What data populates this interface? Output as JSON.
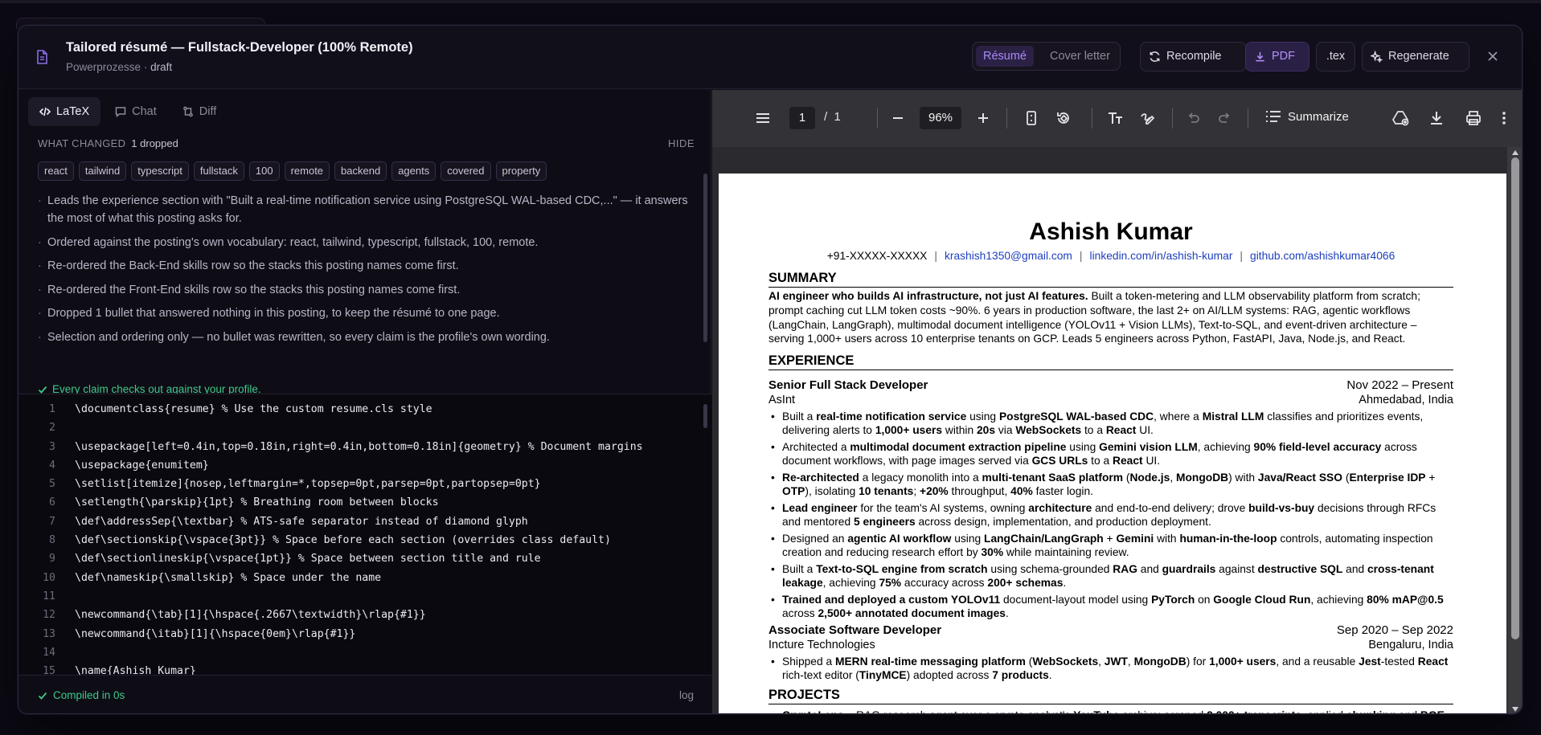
{
  "header": {
    "title": "Tailored résumé — Fullstack-Developer (100% Remote)",
    "company": "Powerprozesse",
    "separator": "·",
    "status": "draft",
    "seg_resume": "Résumé",
    "seg_cover": "Cover letter",
    "recompile": "Recompile",
    "pdf": "PDF",
    "tex": ".tex",
    "regenerate": "Regenerate"
  },
  "left": {
    "tabs": [
      "LaTeX",
      "Chat",
      "Diff"
    ],
    "what_changed": "WHAT CHANGED",
    "dropped": "1 dropped",
    "hide": "HIDE",
    "chips": [
      "react",
      "tailwind",
      "typescript",
      "fullstack",
      "100",
      "remote",
      "backend",
      "agents",
      "covered",
      "property"
    ],
    "notes": [
      "Leads the experience section with \"Built a real-time notification service using PostgreSQL WAL-based CDC,...\" — it answers the most of what this posting asks for.",
      "Ordered against the posting's own vocabulary: react, tailwind, typescript, fullstack, 100, remote.",
      "Re-ordered the Back-End skills row so the stacks this posting names come first.",
      "Re-ordered the Front-End skills row so the stacks this posting names come first.",
      "Dropped 1 bullet that answered nothing in this posting, to keep the résumé to one page.",
      "Selection and ordering only — no bullet was rewritten, so every claim is the profile's own wording."
    ],
    "ok_line": "Every claim checks out against your profile.",
    "code_lines": [
      "\\documentclass{resume} % Use the custom resume.cls style",
      "",
      "\\usepackage[left=0.4in,top=0.18in,right=0.4in,bottom=0.18in]{geometry} % Document margins",
      "\\usepackage{enumitem}",
      "\\setlist[itemize]{nosep,leftmargin=*,topsep=0pt,parsep=0pt,partopsep=0pt}",
      "\\setlength{\\parskip}{1pt} % Breathing room between blocks",
      "\\def\\addressSep{\\textbar} % ATS-safe separator instead of diamond glyph",
      "\\def\\sectionskip{\\vspace{3pt}} % Space before each section (overrides class default)",
      "\\def\\sectionlineskip{\\vspace{1pt}} % Space between section title and rule",
      "\\def\\nameskip{\\smallskip} % Space under the name",
      "",
      "\\newcommand{\\tab}[1]{\\hspace{.2667\\textwidth}\\rlap{#1}}",
      "\\newcommand{\\itab}[1]{\\hspace{0em}\\rlap{#1}}",
      "",
      "\\name{Ashish Kumar}",
      ""
    ],
    "compiled": "Compiled in 0s",
    "log": "log"
  },
  "viewer": {
    "page_current": "1",
    "page_sep": "/",
    "page_total": "1",
    "zoom": "96%",
    "summarize": "Summarize"
  },
  "resume": {
    "name": "Ashish Kumar",
    "phone": "+91-XXXXX-XXXXX",
    "email": "krashish1350@gmail.com",
    "linkedin": "linkedin.com/in/ashish-kumar",
    "github": "github.com/ashishkumar4066",
    "pipe": "|",
    "summary_title": "SUMMARY",
    "experience_title": "EXPERIENCE",
    "projects_title": "PROJECTS",
    "job1_title": "Senior Full Stack Developer",
    "job1_dates": "Nov 2022 – Present",
    "job1_company": "AsInt",
    "job1_location": "Ahmedabad, India",
    "job2_title": "Associate Software Developer",
    "job2_dates": "Sep 2020 – Sep 2022",
    "job2_company": "Incture Technologies",
    "job2_location": "Bengaluru, India"
  }
}
